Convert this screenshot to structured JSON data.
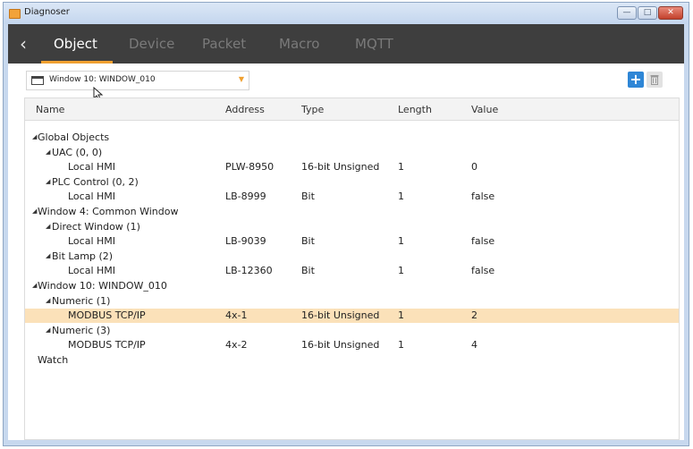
{
  "titlebar": {
    "title": "Diagnoser"
  },
  "tabs": [
    {
      "label": "Object",
      "active": true
    },
    {
      "label": "Device",
      "active": false
    },
    {
      "label": "Packet",
      "active": false
    },
    {
      "label": "Macro",
      "active": false
    },
    {
      "label": "MQTT",
      "active": false
    }
  ],
  "window_selector": {
    "value": "Window 10: WINDOW_010"
  },
  "columns": {
    "name": "Name",
    "address": "Address",
    "type": "Type",
    "length": "Length",
    "value": "Value"
  },
  "rows": [
    {
      "name": "Global Objects",
      "level": 0,
      "expanded": true
    },
    {
      "name": "UAC (0, 0)",
      "level": 1,
      "expanded": true
    },
    {
      "name": "Local HMI",
      "level": 2,
      "address": "PLW-8950",
      "type": "16-bit Unsigned",
      "length": "1",
      "value": "0"
    },
    {
      "name": "PLC Control (0, 2)",
      "level": 1,
      "expanded": true
    },
    {
      "name": "Local HMI",
      "level": 2,
      "address": "LB-8999",
      "type": "Bit",
      "length": "1",
      "value": "false"
    },
    {
      "name": "Window 4: Common Window",
      "level": 0,
      "expanded": true
    },
    {
      "name": "Direct Window (1)",
      "level": 1,
      "expanded": true
    },
    {
      "name": "Local HMI",
      "level": 2,
      "address": "LB-9039",
      "type": "Bit",
      "length": "1",
      "value": "false"
    },
    {
      "name": "Bit Lamp (2)",
      "level": 1,
      "expanded": true
    },
    {
      "name": "Local HMI",
      "level": 2,
      "address": "LB-12360",
      "type": "Bit",
      "length": "1",
      "value": "false"
    },
    {
      "name": "Window 10: WINDOW_010",
      "level": 0,
      "expanded": true
    },
    {
      "name": "Numeric (1)",
      "level": 1,
      "expanded": true
    },
    {
      "name": "MODBUS TCP/IP",
      "level": 2,
      "address": "4x-1",
      "type": "16-bit Unsigned",
      "length": "1",
      "value": "2",
      "selected": true
    },
    {
      "name": "Numeric (3)",
      "level": 1,
      "expanded": true
    },
    {
      "name": "MODBUS TCP/IP",
      "level": 2,
      "address": "4x-2",
      "type": "16-bit Unsigned",
      "length": "1",
      "value": "4"
    },
    {
      "name": "Watch",
      "level": -1
    }
  ],
  "colors": {
    "accent": "#f0a030",
    "tabbar": "#3e3e3e",
    "selected_row": "#fbe1b9",
    "add_button": "#2e86d6"
  }
}
